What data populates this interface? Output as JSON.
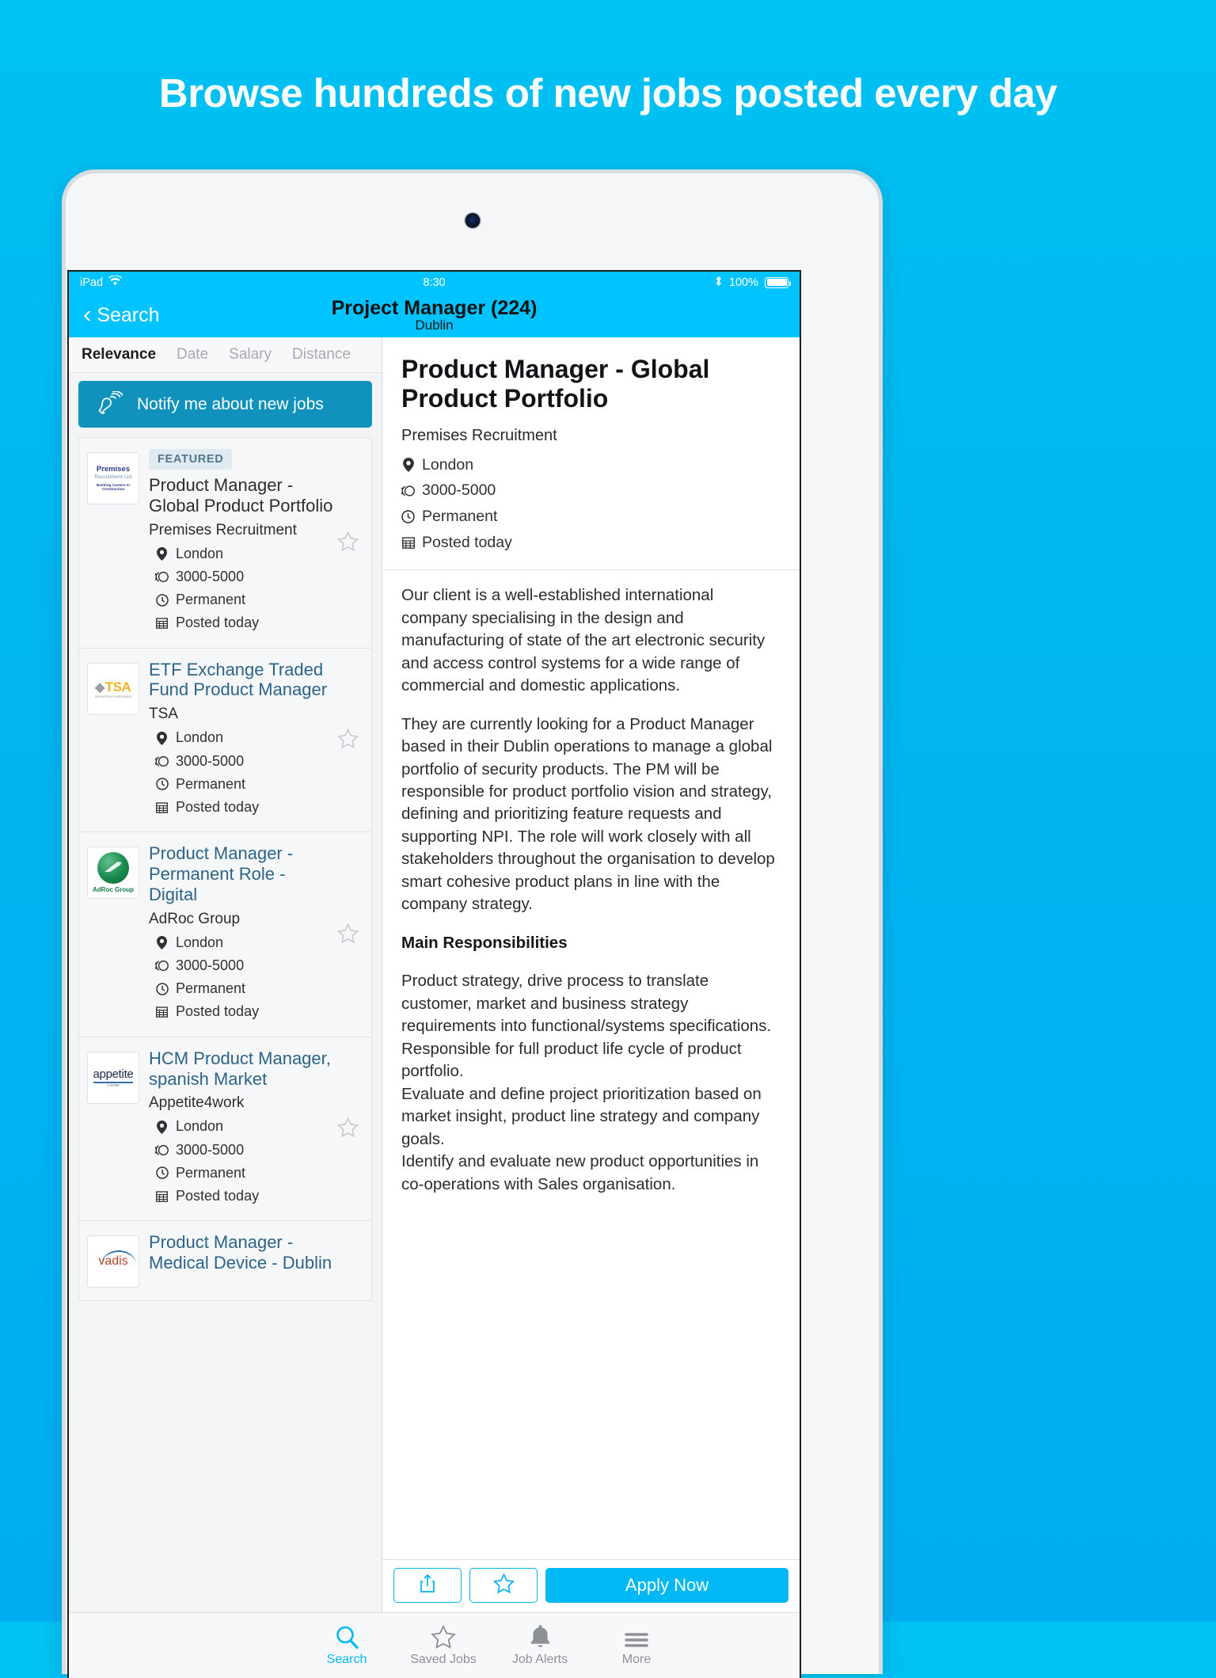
{
  "hero": {
    "headline": "Browse hundreds of new jobs posted every day"
  },
  "status_bar": {
    "device": "iPad",
    "wifi_icon": "wifi-icon",
    "time": "8:30",
    "bluetooth_icon": "bluetooth-icon",
    "battery_percent": "100%"
  },
  "nav": {
    "back_label": "Search",
    "title": "Project Manager (224)",
    "subtitle": "Dublin"
  },
  "sort_tabs": [
    {
      "label": "Relevance",
      "active": true
    },
    {
      "label": "Date",
      "active": false
    },
    {
      "label": "Salary",
      "active": false
    },
    {
      "label": "Distance",
      "active": false
    }
  ],
  "notify_banner": {
    "label": "Notify me about new jobs",
    "icon": "bell-ringing-icon",
    "background": "#1192bd"
  },
  "job_list": [
    {
      "badge": "FEATURED",
      "title": "Product Manager - Global Product Portfolio",
      "company": "Premises Recruitment",
      "location": "London",
      "salary": "3000-5000",
      "contract": "Permanent",
      "posted": "Posted today",
      "logo_name": "premises-recruitment-logo",
      "logo_line1": "Premises",
      "logo_line2": "Recruitment Ltd",
      "logo_line3": "Building Careers In Construction"
    },
    {
      "badge": "",
      "title": "ETF Exchange Traded Fund Product Manager",
      "company": "TSA",
      "location": "London",
      "salary": "3000-5000",
      "contract": "Permanent",
      "posted": "Posted today",
      "logo_name": "tsa-logo",
      "logo_line1": "TSA",
      "logo_line2": "RECRUITING WORLDWIDE",
      "logo_line3": ""
    },
    {
      "badge": "",
      "title": "Product Manager - Permanent Role - Digital",
      "company": "AdRoc Group",
      "location": "London",
      "salary": "3000-5000",
      "contract": "Permanent",
      "posted": "Posted today",
      "logo_name": "adroc-group-logo",
      "logo_line1": "AdRoc Group",
      "logo_line2": "",
      "logo_line3": ""
    },
    {
      "badge": "",
      "title": "HCM Product Manager, spanish Market",
      "company": "Appetite4work",
      "location": "London",
      "salary": "3000-5000",
      "contract": "Permanent",
      "posted": "Posted today",
      "logo_name": "appetite-logo",
      "logo_line1": "appetite",
      "logo_line2": "4 WORK",
      "logo_line3": ""
    },
    {
      "badge": "",
      "title": "Product Manager - Medical Device - Dublin",
      "company": "",
      "location": "",
      "salary": "",
      "contract": "",
      "posted": "",
      "logo_name": "vadis-logo",
      "logo_line1": "vadis",
      "logo_line2": "",
      "logo_line3": ""
    }
  ],
  "detail": {
    "title": "Product Manager - Global Product Portfolio",
    "company": "Premises Recruitment",
    "location": "London",
    "salary": "3000-5000",
    "contract": "Permanent",
    "posted": "Posted today",
    "paragraph_1": "Our client is a well-established international company specialising in the design and manufacturing of state of the art electronic security and access control systems for a wide range of commercial and domestic applications.",
    "paragraph_2": "They are currently looking for a Product Manager based in their Dublin operations to manage a global portfolio of security products. The PM will be responsible for product portfolio vision and strategy, defining and prioritizing feature requests and supporting NPI. The role will work closely with all stakeholders throughout the organisation to develop smart cohesive product plans in line with the company strategy.",
    "heading_responsibilities": "Main Responsibilities",
    "paragraph_3": "Product strategy, drive process to translate customer, market and business strategy requirements into functional/systems specifications.\nResponsible for full product life cycle of product portfolio.\nEvaluate and define project prioritization based on market insight, product line strategy and company goals.\nIdentify and evaluate new product opportunities in co-operations with Sales organisation."
  },
  "action_bar": {
    "share_icon": "share-icon",
    "save_icon": "star-icon",
    "apply_label": "Apply Now",
    "apply_color": "#00b8f4"
  },
  "tab_bar": [
    {
      "label": "Search",
      "icon": "search-icon",
      "active": true
    },
    {
      "label": "Saved Jobs",
      "icon": "star-icon",
      "active": false
    },
    {
      "label": "Job Alerts",
      "icon": "bell-icon",
      "active": false
    },
    {
      "label": "More",
      "icon": "hamburger-icon",
      "active": false
    }
  ]
}
